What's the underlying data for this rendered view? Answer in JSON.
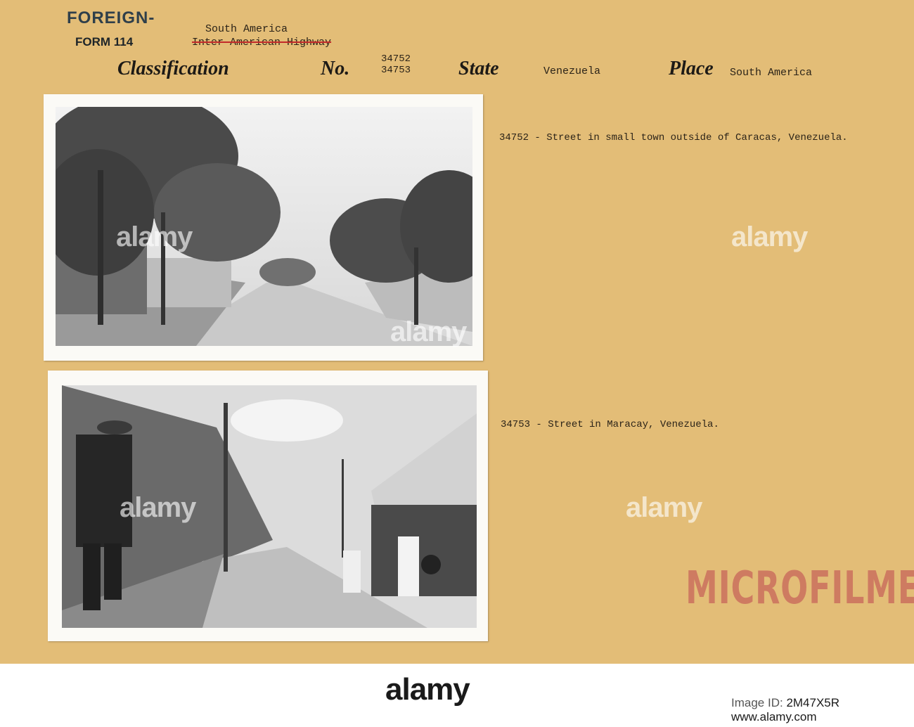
{
  "form_header": {
    "category": "FOREIGN-",
    "form_number": "FORM 114",
    "region_note": "South America",
    "struck_note": "Inter American Highway",
    "classification_label": "Classification",
    "number_label": "No.",
    "numbers": "34752\n34753",
    "state_label": "State",
    "state_value": "Venezuela",
    "place_label": "Place",
    "place_value": "South America"
  },
  "photos": [
    {
      "caption": "34752 - Street in small town outside of Caracas, Venezuela."
    },
    {
      "caption": "34753 - Street in Maracay, Venezuela."
    }
  ],
  "stamp": "MICROFILMED",
  "watermark": "alamy",
  "footer": {
    "logo": "alamy",
    "image_id_label": "Image ID:",
    "image_id": "2M47X5R",
    "site": "www.alamy.com"
  },
  "colors": {
    "card": "#e3bd77",
    "stamp": "#be4650",
    "strike": "#c22a2a"
  }
}
